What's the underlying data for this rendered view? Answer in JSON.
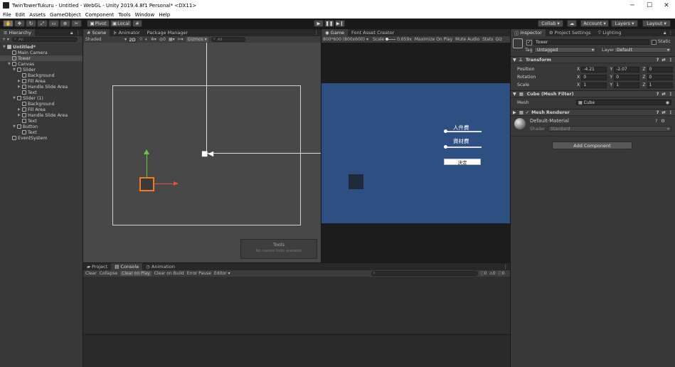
{
  "window": {
    "title": "TwinTowerTukuru - Untitled - WebGL - Unity 2019.4.8f1 Personal* <DX11>",
    "minimize": "─",
    "maximize": "☐",
    "close": "✕"
  },
  "menu": [
    "File",
    "Edit",
    "Assets",
    "GameObject",
    "Component",
    "Tools",
    "Window",
    "Help"
  ],
  "toolbar": {
    "pivot": "Pivot",
    "local": "Local",
    "collab": "Collab ▾",
    "account": "Account ▾",
    "layers": "Layers ▾",
    "layout": "Layout ▾"
  },
  "hierarchy": {
    "tab": "Hierarchy",
    "add": "+ ▾",
    "search_placeholder": "All",
    "items": [
      {
        "label": "Untitled*",
        "depth": 0,
        "arrow": "▼",
        "selected": false,
        "scene": true
      },
      {
        "label": "Main Camera",
        "depth": 1,
        "arrow": "",
        "selected": false
      },
      {
        "label": "Tower",
        "depth": 1,
        "arrow": "",
        "selected": true
      },
      {
        "label": "Canvas",
        "depth": 1,
        "arrow": "▼",
        "selected": false
      },
      {
        "label": "Slider",
        "depth": 2,
        "arrow": "▼",
        "selected": false
      },
      {
        "label": "Background",
        "depth": 3,
        "arrow": "",
        "selected": false
      },
      {
        "label": "Fill Area",
        "depth": 3,
        "arrow": "▶",
        "selected": false
      },
      {
        "label": "Handle Slide Area",
        "depth": 3,
        "arrow": "▶",
        "selected": false
      },
      {
        "label": "Text",
        "depth": 3,
        "arrow": "",
        "selected": false
      },
      {
        "label": "Slider (1)",
        "depth": 2,
        "arrow": "▼",
        "selected": false
      },
      {
        "label": "Background",
        "depth": 3,
        "arrow": "",
        "selected": false
      },
      {
        "label": "Fill Area",
        "depth": 3,
        "arrow": "▶",
        "selected": false
      },
      {
        "label": "Handle Slide Area",
        "depth": 3,
        "arrow": "▶",
        "selected": false
      },
      {
        "label": "Text",
        "depth": 3,
        "arrow": "",
        "selected": false
      },
      {
        "label": "Button",
        "depth": 2,
        "arrow": "▼",
        "selected": false
      },
      {
        "label": "Text",
        "depth": 3,
        "arrow": "",
        "selected": false
      },
      {
        "label": "EventSystem",
        "depth": 1,
        "arrow": "",
        "selected": false
      }
    ]
  },
  "scene": {
    "tabs": [
      "Scene",
      "Animator",
      "Package Manager"
    ],
    "shading": "Shaded",
    "mode_2d": "2D",
    "gizmos": "Gizmos ▾",
    "search_placeholder": "All",
    "tools_overlay_title": "Tools",
    "tools_overlay_text": "No custom tools available"
  },
  "game": {
    "tabs": [
      "Game",
      "Font Asset Creator"
    ],
    "resolution": "800*600 (800x600)",
    "scale_label": "Scale",
    "scale_value": "0.659x",
    "maximize_on_play": "Maximize On Play",
    "mute_audio": "Mute Audio",
    "stats": "Stats",
    "gizmos": "Giz",
    "ui": {
      "slider1_label": "人件費",
      "slider2_label": "資材費",
      "button_label": "決定"
    },
    "bg_color": "#2e4f82"
  },
  "console": {
    "tabs": [
      "Project",
      "Console",
      "Animation"
    ],
    "buttons": [
      "Clear",
      "Collapse",
      "Clear on Play",
      "Clear on Build",
      "Error Pause",
      "Editor ▾"
    ],
    "counts": [
      "0",
      "0",
      "0"
    ]
  },
  "inspector": {
    "tabs": [
      "Inspector",
      "Project Settings",
      "Lighting"
    ],
    "object_name": "Tower",
    "static_label": "Static",
    "tag_label": "Tag",
    "tag_value": "Untagged",
    "layer_label": "Layer",
    "layer_value": "Default",
    "transform": {
      "title": "Transform",
      "rows": [
        {
          "label": "Position",
          "x": "-4.21",
          "y": "-2.07",
          "z": "0"
        },
        {
          "label": "Rotation",
          "x": "0",
          "y": "0",
          "z": "0"
        },
        {
          "label": "Scale",
          "x": "1",
          "y": "1",
          "z": "1"
        }
      ]
    },
    "mesh_filter": {
      "title": "Cube (Mesh Filter)",
      "mesh_label": "Mesh",
      "mesh_value": "Cube"
    },
    "mesh_renderer": {
      "title": "Mesh Renderer"
    },
    "material": {
      "name": "Default-Material",
      "shader_label": "Shader",
      "shader_value": "Standard"
    },
    "add_component": "Add Component"
  }
}
